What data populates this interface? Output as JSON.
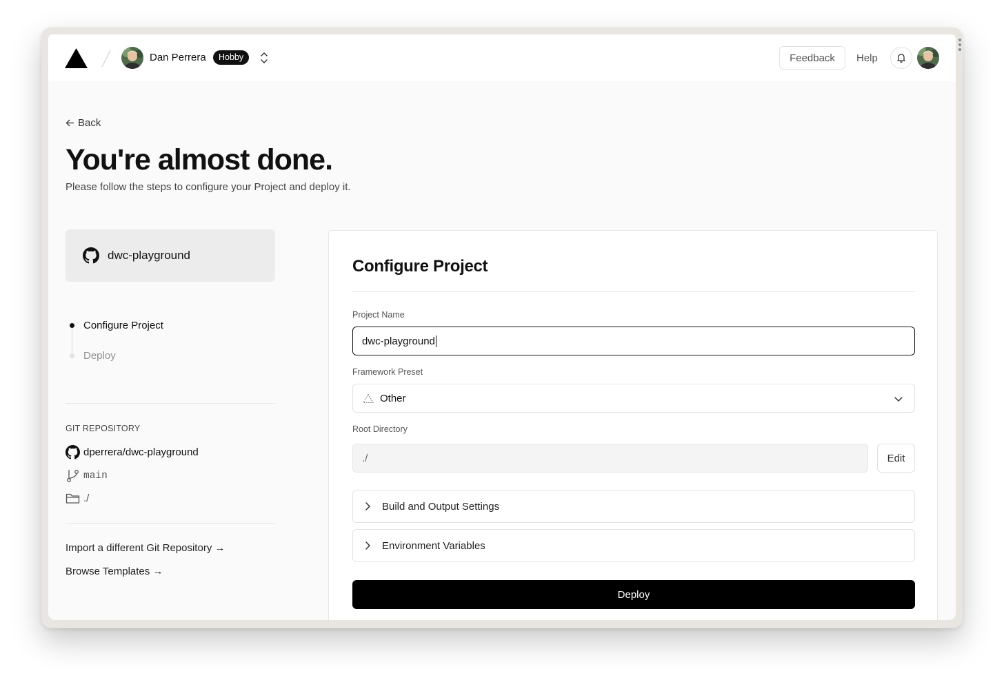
{
  "header": {
    "team_name": "Dan Perrera",
    "plan_badge": "Hobby",
    "feedback_label": "Feedback",
    "help_label": "Help"
  },
  "intro": {
    "back_label": "Back",
    "title": "You're almost done.",
    "subtitle": "Please follow the steps to configure your Project and deploy it."
  },
  "sidebar": {
    "repo_card_name": "dwc-playground",
    "steps": [
      {
        "label": "Configure Project",
        "active": true
      },
      {
        "label": "Deploy",
        "active": false
      }
    ],
    "git": {
      "heading": "GIT REPOSITORY",
      "repository": "dperrera/dwc-playground",
      "branch": "main",
      "directory": "./"
    },
    "links": {
      "import_other": "Import a different Git Repository →",
      "browse_templates": "Browse Templates →"
    }
  },
  "configure": {
    "title": "Configure Project",
    "project_name_label": "Project Name",
    "project_name_value": "dwc-playground",
    "framework_label": "Framework Preset",
    "framework_value": "Other",
    "root_dir_label": "Root Directory",
    "root_dir_value": "./",
    "edit_label": "Edit",
    "build_settings_label": "Build and Output Settings",
    "env_vars_label": "Environment Variables",
    "deploy_label": "Deploy"
  },
  "icons": {
    "logo": "vercel-triangle-icon",
    "notifications": "bell-icon",
    "repo": "github-icon",
    "branch": "git-branch-icon",
    "directory": "folder-icon",
    "framework": "framework-triangle-icon"
  },
  "colors": {
    "primary": "#000000",
    "background": "#fafafa",
    "card": "#ececec"
  }
}
